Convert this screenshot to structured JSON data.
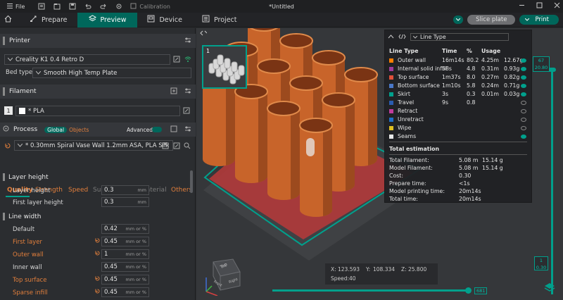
{
  "titlebar": {
    "file_label": "File",
    "calibration_label": "Calibration",
    "document_title": "*Untitled"
  },
  "tabs": [
    {
      "label": "Prepare"
    },
    {
      "label": "Preview"
    },
    {
      "label": "Device"
    },
    {
      "label": "Project"
    }
  ],
  "actions": {
    "slice_label": "Slice plate",
    "print_label": "Print"
  },
  "printer": {
    "section_label": "Printer",
    "printer_name": "Creality K1 0.4 Retro D",
    "bed_type_label": "Bed type",
    "bed_type_value": "Smooth High Temp Plate"
  },
  "filament": {
    "section_label": "Filament",
    "slot_number": "1",
    "filament_name": "* PLA"
  },
  "process": {
    "section_label": "Process",
    "global_label": "Global",
    "objects_label": "Objects",
    "advanced_label": "Advanced",
    "profile_name": "* 0.30mm Spiral Vase Wall 1.2mm ASA, PLA Silk",
    "subtabs": [
      "Quality",
      "Strength",
      "Speed",
      "Support",
      "Multimaterial",
      "Others"
    ],
    "layer_height_group": "Layer height",
    "layer_height_label": "Layer height",
    "layer_height_value": "0.3",
    "layer_height_unit": "mm",
    "first_layer_height_label": "First layer height",
    "first_layer_height_value": "0.3",
    "first_layer_height_unit": "mm",
    "line_width_group": "Line width",
    "line_widths": [
      {
        "label": "Default",
        "value": "0.42",
        "unit": "mm or %",
        "modified": false
      },
      {
        "label": "First layer",
        "value": "0.45",
        "unit": "mm or %",
        "modified": true
      },
      {
        "label": "Outer wall",
        "value": "1",
        "unit": "mm or %",
        "modified": true
      },
      {
        "label": "Inner wall",
        "value": "0.45",
        "unit": "mm or %",
        "modified": false
      },
      {
        "label": "Top surface",
        "value": "0.45",
        "unit": "mm or %",
        "modified": true
      },
      {
        "label": "Sparse infill",
        "value": "0.45",
        "unit": "mm or %",
        "modified": true
      }
    ]
  },
  "viewport": {
    "plate_number": "1",
    "layer_top_number": "67",
    "layer_top_height": "20.80",
    "layer_bottom_number": "1",
    "layer_bottom_height": "0.30",
    "move_slider_value": "681",
    "cube_top_label": "Top",
    "cube_front_label": "Front",
    "cube_right_label": "Right"
  },
  "legend": {
    "view_type": "Line Type",
    "columns": [
      "Line Type",
      "Time",
      "%",
      "Usage"
    ],
    "rows": [
      {
        "name": "Outer wall",
        "color": "#ff7f00",
        "time": "16m14s",
        "pct": "80.2",
        "len": "4.25m",
        "weight": "12.67g",
        "visible": true
      },
      {
        "name": "Internal solid infill",
        "color": "#9b3a9b",
        "time": "58s",
        "pct": "4.8",
        "len": "0.31m",
        "weight": "0.93g",
        "visible": true
      },
      {
        "name": "Top surface",
        "color": "#e0503a",
        "time": "1m37s",
        "pct": "8.0",
        "len": "0.27m",
        "weight": "0.82g",
        "visible": true
      },
      {
        "name": "Bottom surface",
        "color": "#4a78c8",
        "time": "1m10s",
        "pct": "5.8",
        "len": "0.24m",
        "weight": "0.71g",
        "visible": true
      },
      {
        "name": "Skirt",
        "color": "#00a08c",
        "time": "3s",
        "pct": "0.3",
        "len": "0.01m",
        "weight": "0.03g",
        "visible": true
      },
      {
        "name": "Travel",
        "color": "#2a5cb0",
        "time": "9s",
        "pct": "0.8",
        "len": "",
        "weight": "",
        "visible": false
      },
      {
        "name": "Retract",
        "color": "#c03c9c",
        "time": "",
        "pct": "",
        "len": "",
        "weight": "",
        "visible": false
      },
      {
        "name": "Unretract",
        "color": "#1f6fc8",
        "time": "",
        "pct": "",
        "len": "",
        "weight": "",
        "visible": false
      },
      {
        "name": "Wipe",
        "color": "#e0c020",
        "time": "",
        "pct": "",
        "len": "",
        "weight": "",
        "visible": false
      },
      {
        "name": "Seams",
        "color": "#e8e8e8",
        "time": "",
        "pct": "",
        "len": "",
        "weight": "",
        "visible": true
      }
    ],
    "total_estimation_label": "Total estimation",
    "totals": [
      {
        "label": "Total Filament:",
        "len": "5.08 m",
        "weight": "15.14 g"
      },
      {
        "label": "Model Filament:",
        "len": "5.08 m",
        "weight": "15.14 g"
      },
      {
        "label": "Cost:",
        "len": "0.30",
        "weight": ""
      },
      {
        "label": "Prepare time:",
        "len": "<1s",
        "weight": ""
      },
      {
        "label": "Model printing time:",
        "len": "20m14s",
        "weight": ""
      },
      {
        "label": "Total time:",
        "len": "20m14s",
        "weight": ""
      }
    ]
  },
  "coords": {
    "x_label": "X:",
    "x_value": "123.593",
    "y_label": "Y:",
    "y_value": "108.334",
    "z_label": "Z:",
    "z_value": "25.800",
    "speed_label": "Speed:",
    "speed_value": "40"
  },
  "colors": {
    "accent": "#00675b",
    "modified": "#e27f3c",
    "model": "#c8642a",
    "plate_border": "#00a08c"
  }
}
